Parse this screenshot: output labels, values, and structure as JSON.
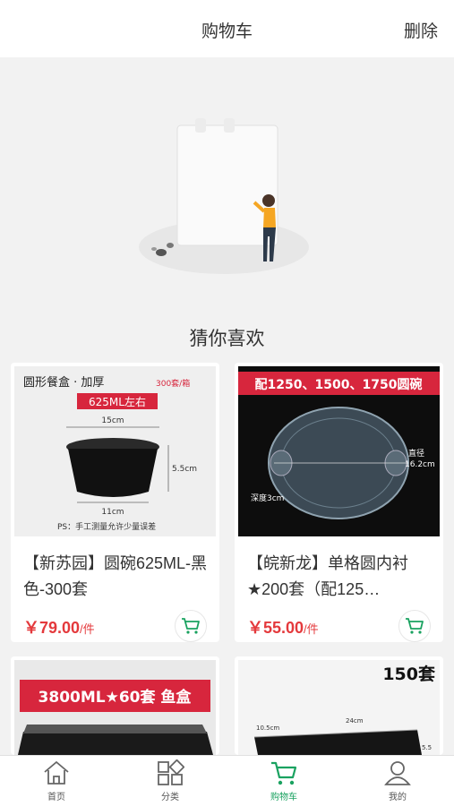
{
  "header": {
    "title": "购物车",
    "delete_label": "删除"
  },
  "recommend": {
    "title": "猜你喜欢"
  },
  "products": [
    {
      "name": "【新苏园】圆碗625ML-黑色-300套",
      "price": "￥79.00",
      "unit": "/件",
      "image": {
        "heading": "圆形餐盒 · 加厚",
        "badge": "300套/箱",
        "capacity": "625ML左右",
        "dim_top": "15cm",
        "dim_side": "5.5cm",
        "dim_bottom": "11cm",
        "note": "PS：手工测量允许少量误差"
      }
    },
    {
      "name": "【皖新龙】单格圆内衬★200套（配125…",
      "price": "￥55.00",
      "unit": "/件",
      "image": {
        "banner": "配1250、1500、1750圆碗",
        "diameter_label": "直径",
        "diameter": "16.2cm",
        "depth": "深度3cm"
      }
    },
    {
      "name": "",
      "image": {
        "banner": "3800ML★60套 鱼盒"
      }
    },
    {
      "name": "",
      "image": {
        "badge": "150套",
        "dim_a": "10.5cm",
        "dim_b": "24cm",
        "dim_c": "5.5"
      }
    }
  ],
  "tabbar": {
    "items": [
      {
        "label": "首页",
        "icon": "home-icon"
      },
      {
        "label": "分类",
        "icon": "category-icon"
      },
      {
        "label": "购物车",
        "icon": "cart-icon",
        "active": true
      },
      {
        "label": "我的",
        "icon": "user-icon"
      }
    ]
  },
  "colors": {
    "accent": "#1aa260",
    "price": "#e4393c",
    "banner_red": "#d7263d"
  }
}
